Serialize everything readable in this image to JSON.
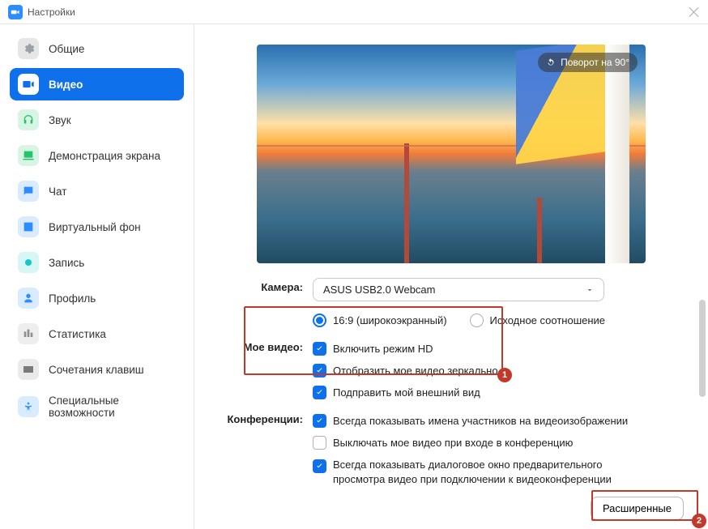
{
  "window": {
    "title": "Настройки"
  },
  "sidebar": {
    "items": [
      {
        "id": "general",
        "label": "Общие"
      },
      {
        "id": "video",
        "label": "Видео"
      },
      {
        "id": "audio",
        "label": "Звук"
      },
      {
        "id": "share",
        "label": "Демонстрация экрана"
      },
      {
        "id": "chat",
        "label": "Чат"
      },
      {
        "id": "vbg",
        "label": "Виртуальный фон"
      },
      {
        "id": "rec",
        "label": "Запись"
      },
      {
        "id": "profile",
        "label": "Профиль"
      },
      {
        "id": "stats",
        "label": "Статистика"
      },
      {
        "id": "keys",
        "label": "Сочетания клавиш"
      },
      {
        "id": "access",
        "label": "Специальные возможности"
      }
    ],
    "active": "video"
  },
  "preview": {
    "rotate_label": "Поворот на 90°"
  },
  "camera": {
    "label": "Камера:",
    "selected": "ASUS USB2.0 Webcam",
    "aspect": {
      "wide": "16:9 (широкоэкранный)",
      "orig": "Исходное соотношение",
      "selected": "wide"
    }
  },
  "my_video": {
    "label": "Мое видео:",
    "hd": {
      "label": "Включить режим HD",
      "checked": true
    },
    "mirror": {
      "label": "Отобразить мое видео зеркально",
      "checked": true
    },
    "touchup": {
      "label": "Подправить мой внешний вид",
      "checked": true
    }
  },
  "meetings": {
    "label": "Конференции:",
    "names": {
      "label": "Всегда показывать имена участников на видеоизображении",
      "checked": true
    },
    "off_on_join": {
      "label": "Выключать мое видео при входе в конференцию",
      "checked": false
    },
    "preview_dialog": {
      "label": "Всегда показывать диалоговое окно предварительного просмотра видео при подключении к видеоконференции",
      "checked": true
    }
  },
  "buttons": {
    "advanced": "Расширенные"
  },
  "annotations": {
    "badge1": "1",
    "badge2": "2"
  }
}
